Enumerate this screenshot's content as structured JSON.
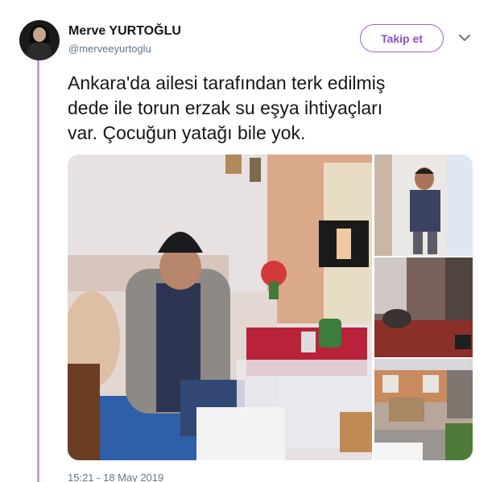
{
  "tweet": {
    "author_name": "Merve YURTOĞLU",
    "author_handle": "@merveeyurtoglu",
    "follow_label": "Takip et",
    "text_line1": "Ankara'da ailesi tarafından terk edilmiş",
    "text_line2": "dede ile torun erzak su  eşya ihtiyaçları",
    "text_line3": "var. Çocuğun yatağı bile yok.",
    "timestamp": "15:21 - 18 May 2019"
  },
  "icons": {
    "more": "chevron-down-icon",
    "avatar": "avatar"
  },
  "colors": {
    "accent": "#8e4ec6",
    "thread_line": "#c89ee6",
    "secondary_text": "#657786"
  }
}
